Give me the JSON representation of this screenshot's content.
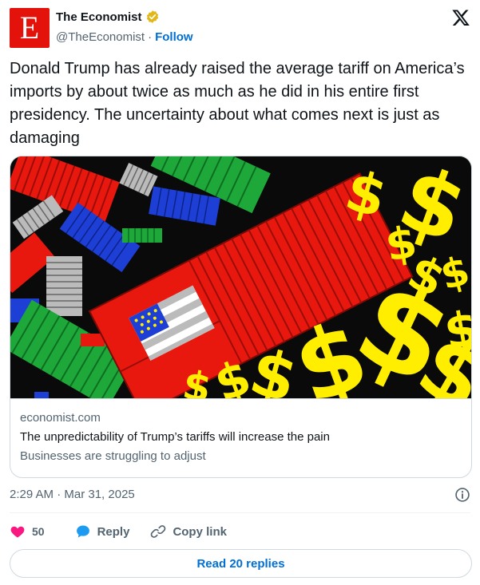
{
  "account": {
    "name": "The Economist",
    "handle": "@TheEconomist",
    "separator": "·",
    "follow_label": "Follow",
    "avatar_letter": "E",
    "avatar_color": "#e3120b",
    "verified_color": "#e2b719"
  },
  "tweet": {
    "text": "Donald Trump has already raised the average tariff on America’s imports by about twice as much as he did in his entire first presidency. The uncertainty about what comes next is just as damaging"
  },
  "card": {
    "domain": "economist.com",
    "title": "The unpredictability of Trump’s tariffs will increase the pain",
    "description": "Businesses are struggling to adjust",
    "image_alt": "Illustration of shipping containers with a US flag and yellow dollar signs"
  },
  "meta": {
    "timestamp": "2:29 AM · Mar 31, 2025"
  },
  "actions": {
    "like_count": "50",
    "reply_label": "Reply",
    "copy_link_label": "Copy link",
    "read_replies_label": "Read 20 replies"
  },
  "icons": {
    "x_logo": "x-logo-icon",
    "verified": "verified-badge-icon",
    "info": "info-icon",
    "like": "heart-icon",
    "reply": "reply-bubble-icon",
    "copy_link": "link-icon"
  },
  "colors": {
    "link_blue": "#006fd6",
    "like_pink": "#f91880",
    "reply_blue": "#1d9bf0",
    "secondary_text": "#536471",
    "container_red": "#e8180f",
    "dollar_yellow": "#ffee00"
  }
}
